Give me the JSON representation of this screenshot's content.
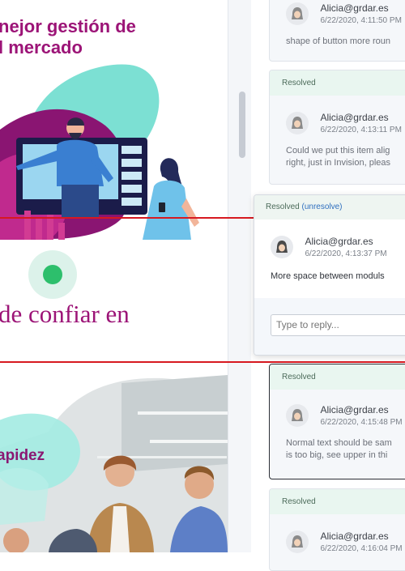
{
  "left": {
    "heading_line1": "nejor gestión de",
    "heading_line2": "l mercado",
    "subheading": "de confiar en",
    "photo_label": "apidez"
  },
  "comments": [
    {
      "status": "",
      "user": "Alicia@grdar.es",
      "time": "6/22/2020, 4:11:50 PM",
      "text": "shape of button more roun"
    },
    {
      "status": "Resolved",
      "user": "Alicia@grdar.es",
      "time": "6/22/2020, 4:13:11 PM",
      "text_line1": "Could we put this item alig",
      "text_line2": "right, just in Invision, pleas"
    },
    {
      "status": "Resolved",
      "user": "Alicia@grdar.es",
      "time": "6/22/2020, 4:15:48 PM",
      "text_line1": "Normal text should be sam",
      "text_line2": "is too big, see upper in thi"
    },
    {
      "status": "Resolved",
      "user": "Alicia@grdar.es",
      "time": "6/22/2020, 4:16:04 PM"
    }
  ],
  "active_comment": {
    "status": "Resolved",
    "unresolve": "(unresolve)",
    "user": "Alicia@grdar.es",
    "time": "6/22/2020, 4:13:37 PM",
    "text": "More space between moduls",
    "reply_placeholder": "Type to reply..."
  },
  "colors": {
    "brand": "#9c1477",
    "marker": "#d71920",
    "accent_green": "#2dbf6c",
    "link": "#2f6fbf"
  }
}
